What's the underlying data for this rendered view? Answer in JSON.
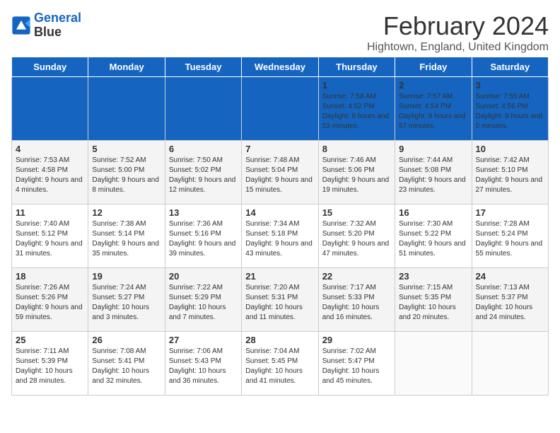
{
  "header": {
    "logo_line1": "General",
    "logo_line2": "Blue",
    "main_title": "February 2024",
    "subtitle": "Hightown, England, United Kingdom"
  },
  "days_of_week": [
    "Sunday",
    "Monday",
    "Tuesday",
    "Wednesday",
    "Thursday",
    "Friday",
    "Saturday"
  ],
  "weeks": [
    [
      {
        "day": "",
        "text": ""
      },
      {
        "day": "",
        "text": ""
      },
      {
        "day": "",
        "text": ""
      },
      {
        "day": "",
        "text": ""
      },
      {
        "day": "1",
        "text": "Sunrise: 7:58 AM\nSunset: 4:52 PM\nDaylight: 8 hours and 53 minutes."
      },
      {
        "day": "2",
        "text": "Sunrise: 7:57 AM\nSunset: 4:54 PM\nDaylight: 8 hours and 57 minutes."
      },
      {
        "day": "3",
        "text": "Sunrise: 7:55 AM\nSunset: 4:56 PM\nDaylight: 9 hours and 0 minutes."
      }
    ],
    [
      {
        "day": "4",
        "text": "Sunrise: 7:53 AM\nSunset: 4:58 PM\nDaylight: 9 hours and 4 minutes."
      },
      {
        "day": "5",
        "text": "Sunrise: 7:52 AM\nSunset: 5:00 PM\nDaylight: 9 hours and 8 minutes."
      },
      {
        "day": "6",
        "text": "Sunrise: 7:50 AM\nSunset: 5:02 PM\nDaylight: 9 hours and 12 minutes."
      },
      {
        "day": "7",
        "text": "Sunrise: 7:48 AM\nSunset: 5:04 PM\nDaylight: 9 hours and 15 minutes."
      },
      {
        "day": "8",
        "text": "Sunrise: 7:46 AM\nSunset: 5:06 PM\nDaylight: 9 hours and 19 minutes."
      },
      {
        "day": "9",
        "text": "Sunrise: 7:44 AM\nSunset: 5:08 PM\nDaylight: 9 hours and 23 minutes."
      },
      {
        "day": "10",
        "text": "Sunrise: 7:42 AM\nSunset: 5:10 PM\nDaylight: 9 hours and 27 minutes."
      }
    ],
    [
      {
        "day": "11",
        "text": "Sunrise: 7:40 AM\nSunset: 5:12 PM\nDaylight: 9 hours and 31 minutes."
      },
      {
        "day": "12",
        "text": "Sunrise: 7:38 AM\nSunset: 5:14 PM\nDaylight: 9 hours and 35 minutes."
      },
      {
        "day": "13",
        "text": "Sunrise: 7:36 AM\nSunset: 5:16 PM\nDaylight: 9 hours and 39 minutes."
      },
      {
        "day": "14",
        "text": "Sunrise: 7:34 AM\nSunset: 5:18 PM\nDaylight: 9 hours and 43 minutes."
      },
      {
        "day": "15",
        "text": "Sunrise: 7:32 AM\nSunset: 5:20 PM\nDaylight: 9 hours and 47 minutes."
      },
      {
        "day": "16",
        "text": "Sunrise: 7:30 AM\nSunset: 5:22 PM\nDaylight: 9 hours and 51 minutes."
      },
      {
        "day": "17",
        "text": "Sunrise: 7:28 AM\nSunset: 5:24 PM\nDaylight: 9 hours and 55 minutes."
      }
    ],
    [
      {
        "day": "18",
        "text": "Sunrise: 7:26 AM\nSunset: 5:26 PM\nDaylight: 9 hours and 59 minutes."
      },
      {
        "day": "19",
        "text": "Sunrise: 7:24 AM\nSunset: 5:27 PM\nDaylight: 10 hours and 3 minutes."
      },
      {
        "day": "20",
        "text": "Sunrise: 7:22 AM\nSunset: 5:29 PM\nDaylight: 10 hours and 7 minutes."
      },
      {
        "day": "21",
        "text": "Sunrise: 7:20 AM\nSunset: 5:31 PM\nDaylight: 10 hours and 11 minutes."
      },
      {
        "day": "22",
        "text": "Sunrise: 7:17 AM\nSunset: 5:33 PM\nDaylight: 10 hours and 16 minutes."
      },
      {
        "day": "23",
        "text": "Sunrise: 7:15 AM\nSunset: 5:35 PM\nDaylight: 10 hours and 20 minutes."
      },
      {
        "day": "24",
        "text": "Sunrise: 7:13 AM\nSunset: 5:37 PM\nDaylight: 10 hours and 24 minutes."
      }
    ],
    [
      {
        "day": "25",
        "text": "Sunrise: 7:11 AM\nSunset: 5:39 PM\nDaylight: 10 hours and 28 minutes."
      },
      {
        "day": "26",
        "text": "Sunrise: 7:08 AM\nSunset: 5:41 PM\nDaylight: 10 hours and 32 minutes."
      },
      {
        "day": "27",
        "text": "Sunrise: 7:06 AM\nSunset: 5:43 PM\nDaylight: 10 hours and 36 minutes."
      },
      {
        "day": "28",
        "text": "Sunrise: 7:04 AM\nSunset: 5:45 PM\nDaylight: 10 hours and 41 minutes."
      },
      {
        "day": "29",
        "text": "Sunrise: 7:02 AM\nSunset: 5:47 PM\nDaylight: 10 hours and 45 minutes."
      },
      {
        "day": "",
        "text": ""
      },
      {
        "day": "",
        "text": ""
      }
    ]
  ]
}
